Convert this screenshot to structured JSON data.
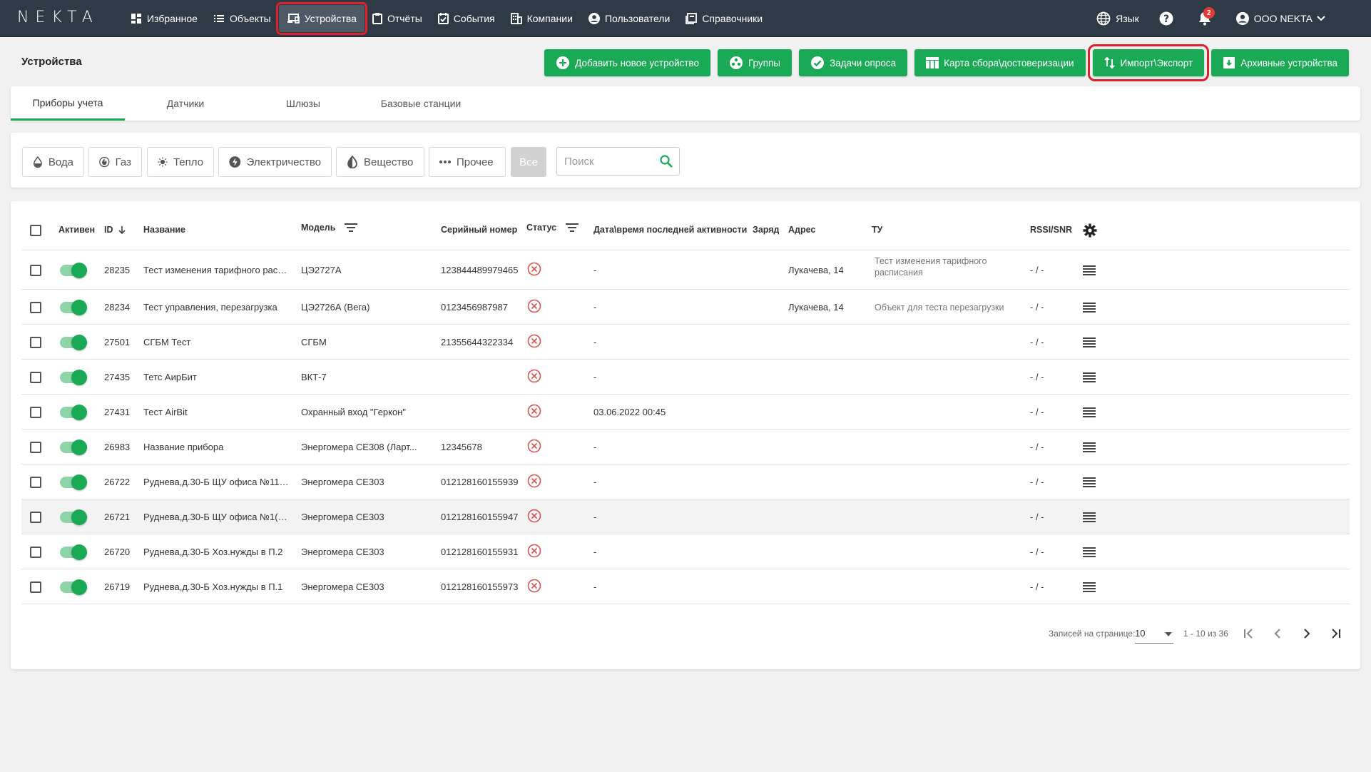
{
  "app": {
    "logo": "NEKTA"
  },
  "nav": {
    "items": [
      {
        "label": "Избранное",
        "icon": "dashboard-icon"
      },
      {
        "label": "Объекты",
        "icon": "list-icon"
      },
      {
        "label": "Устройства",
        "icon": "devices-icon",
        "active": true
      },
      {
        "label": "Отчёты",
        "icon": "clipboard-icon"
      },
      {
        "label": "События",
        "icon": "event-check-icon"
      },
      {
        "label": "Компании",
        "icon": "building-icon"
      },
      {
        "label": "Пользователи",
        "icon": "user-circle-icon"
      },
      {
        "label": "Справочники",
        "icon": "book-icon"
      }
    ],
    "language_label": "Язык",
    "notifications_count": "2",
    "company_label": "ООО NEKTA"
  },
  "page": {
    "title": "Устройства",
    "actions": [
      {
        "label": "Добавить новое устройство",
        "icon": "add-circle-icon"
      },
      {
        "label": "Группы",
        "icon": "groups-icon"
      },
      {
        "label": "Задачи опроса",
        "icon": "check-circle-icon"
      },
      {
        "label": "Карта сбора\\достоверизации",
        "icon": "table-icon"
      },
      {
        "label": "Импорт\\Экспорт",
        "icon": "import-export-icon",
        "highlighted": true
      },
      {
        "label": "Архивные устройства",
        "icon": "archive-icon"
      }
    ]
  },
  "tabs": [
    {
      "label": "Приборы учета",
      "active": true
    },
    {
      "label": "Датчики"
    },
    {
      "label": "Шлюзы"
    },
    {
      "label": "Базовые станции"
    }
  ],
  "filters": {
    "chips": [
      {
        "label": "Вода",
        "icon": "water-drop-icon"
      },
      {
        "label": "Газ",
        "icon": "gas-icon"
      },
      {
        "label": "Тепло",
        "icon": "sun-icon"
      },
      {
        "label": "Электричество",
        "icon": "bolt-icon"
      },
      {
        "label": "Вещество",
        "icon": "substance-drop-icon"
      },
      {
        "label": "Прочее",
        "icon": "more-dots-icon"
      },
      {
        "label": "Все"
      }
    ],
    "search_placeholder": "Поиск"
  },
  "table": {
    "headers": {
      "active": "Активен",
      "id": "ID",
      "name": "Название",
      "model": "Модель",
      "serial": "Серийный номер",
      "status": "Статус",
      "last_activity": "Дата\\время последней активности",
      "charge": "Заряд",
      "address": "Адрес",
      "tu": "ТУ",
      "rssi": "RSSI/SNR"
    },
    "rows": [
      {
        "id": "28235",
        "name": "Тест изменения тарифного распи...",
        "model": "ЦЭ2727А",
        "serial": "123844489979465",
        "last": "-",
        "address": "Лукачева, 14",
        "tu": "Тест изменения тарифного расписания",
        "rssi": "- / -"
      },
      {
        "id": "28234",
        "name": "Тест управления, перезагрузка",
        "model": "ЦЭ2726А (Вега)",
        "serial": "0123456987987",
        "last": "-",
        "address": "Лукачева, 14",
        "tu": "Объект для теста перезагрузки",
        "rssi": "- / -"
      },
      {
        "id": "27501",
        "name": "СГБМ Тест",
        "model": "СГБМ",
        "serial": "21355644322334",
        "last": "-",
        "address": "",
        "tu": "",
        "rssi": "- / -"
      },
      {
        "id": "27435",
        "name": "Тетс АирБит",
        "model": "ВКТ-7",
        "serial": "",
        "last": "-",
        "address": "",
        "tu": "",
        "rssi": "- / -"
      },
      {
        "id": "27431",
        "name": "Тест AirBit",
        "model": "Охранный вход \"Геркон\"",
        "serial": "",
        "last": "03.06.2022 00:45",
        "address": "",
        "tu": "",
        "rssi": "- / -"
      },
      {
        "id": "26983",
        "name": "Название прибора",
        "model": "Энергомера CE308 (Ларт...",
        "serial": "12345678",
        "last": "-",
        "address": "",
        "tu": "",
        "rssi": "- / -"
      },
      {
        "id": "26722",
        "name": "Руднева,д.30-Б ЩУ офиса №11(П....",
        "model": "Энергомера CE303",
        "serial": "012128160155939",
        "last": "-",
        "address": "",
        "tu": "",
        "rssi": "- / -"
      },
      {
        "id": "26721",
        "name": "Руднева,д.30-Б ЩУ офиса №1(П.1...",
        "model": "Энергомера CE303",
        "serial": "012128160155947",
        "last": "-",
        "address": "",
        "tu": "",
        "rssi": "- / -"
      },
      {
        "id": "26720",
        "name": "Руднева,д.30-Б Хоз.нужды в П.2",
        "model": "Энергомера CE303",
        "serial": "012128160155931",
        "last": "-",
        "address": "",
        "tu": "",
        "rssi": "- / -"
      },
      {
        "id": "26719",
        "name": "Руднева,д.30-Б Хоз.нужды в П.1",
        "model": "Энергомера CE303",
        "serial": "012128160155973",
        "last": "-",
        "address": "",
        "tu": "",
        "rssi": "- / -"
      }
    ]
  },
  "pagination": {
    "per_page_label": "Записей на странице:",
    "per_page_value": "10",
    "range_label": "1 - 10 из 36"
  },
  "colors": {
    "nav_bg": "#2e3a46",
    "accent_green": "#1aaa55",
    "status_error": "#d9534f",
    "highlight_red": "#e0202a"
  }
}
